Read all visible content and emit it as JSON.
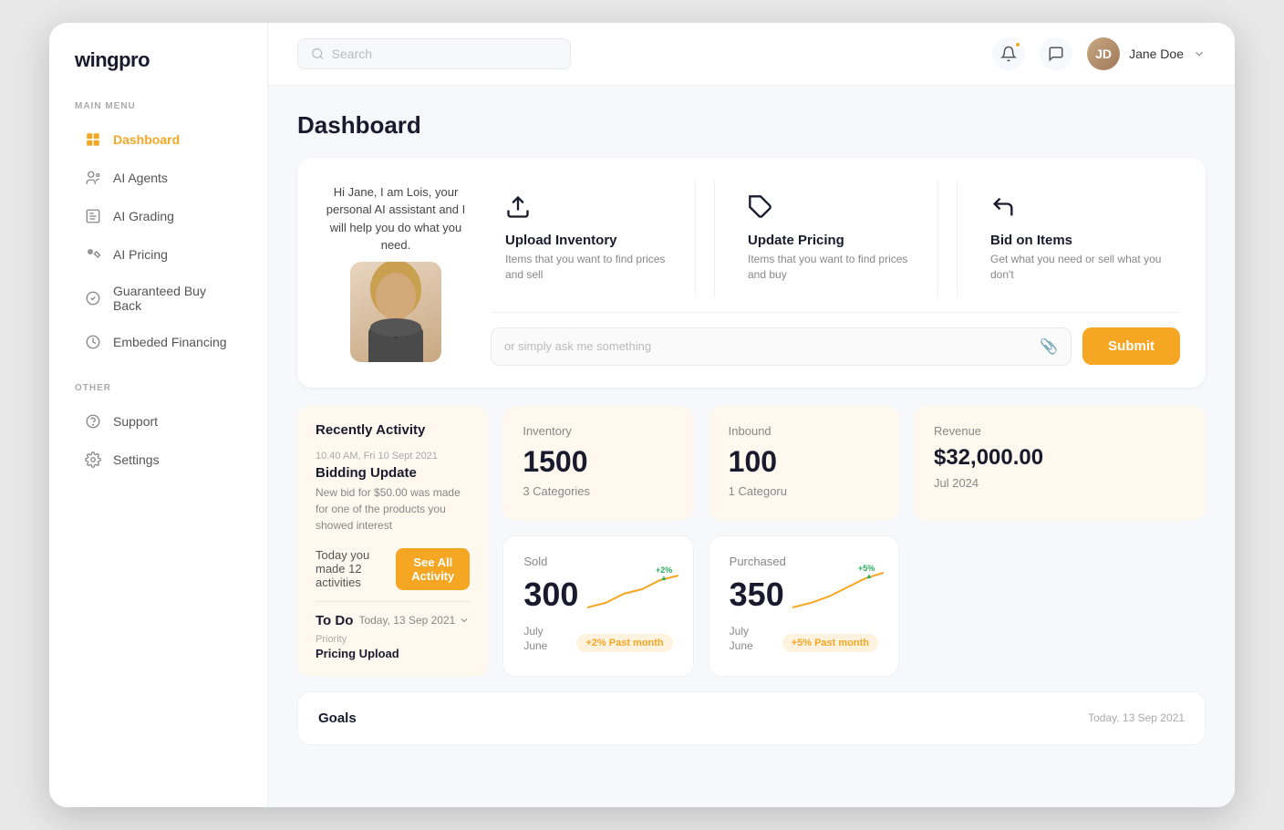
{
  "app": {
    "name": "wingpro"
  },
  "sidebar": {
    "main_menu_label": "MAIN MENU",
    "other_label": "OTHER",
    "items": [
      {
        "id": "dashboard",
        "label": "Dashboard",
        "active": true
      },
      {
        "id": "ai-agents",
        "label": "AI Agents",
        "active": false
      },
      {
        "id": "ai-grading",
        "label": "AI Grading",
        "active": false
      },
      {
        "id": "ai-pricing",
        "label": "AI Pricing",
        "active": false
      },
      {
        "id": "guaranteed-buyback",
        "label": "Guaranteed Buy Back",
        "active": false
      },
      {
        "id": "embedded-financing",
        "label": "Embeded Financing",
        "active": false
      }
    ],
    "other_items": [
      {
        "id": "support",
        "label": "Support"
      },
      {
        "id": "settings",
        "label": "Settings"
      }
    ]
  },
  "topbar": {
    "search_placeholder": "Search",
    "user_name": "Jane Doe"
  },
  "page": {
    "title": "Dashboard"
  },
  "ai_banner": {
    "greeting": "Hi Jane, I am Lois, your personal AI assistant and I will help you do what you need.",
    "actions": [
      {
        "title": "Upload Inventory",
        "description": "Items that you want to find prices and sell",
        "icon": "↑"
      },
      {
        "title": "Update Pricing",
        "description": "Items that you want to find prices and buy",
        "icon": "◇"
      },
      {
        "title": "Bid on Items",
        "description": "Get what you need or sell what you don't",
        "icon": "←"
      }
    ],
    "input_placeholder": "or simply ask me something",
    "submit_label": "Submit"
  },
  "stats": [
    {
      "label": "Inventory",
      "value": "1500",
      "sub": "3 Categories"
    },
    {
      "label": "Inbound",
      "value": "100",
      "sub": "1 Categoru"
    },
    {
      "label": "Revenue",
      "value": "$32,000.00",
      "sub": "Jul 2024"
    }
  ],
  "activity": {
    "title": "Recently Activity",
    "timestamp": "10.40 AM, Fri 10 Sept 2021",
    "event_title": "Bidding Update",
    "event_desc": "New bid for $50.00 was made for one of the products you showed interest",
    "count_text": "Today you made 12 activities",
    "see_all_label": "See All Activity"
  },
  "todo": {
    "title": "To Do",
    "date_label": "Today, 13 Sep 2021",
    "priority_label": "Priority",
    "item_title": "Pricing Upload"
  },
  "metrics": [
    {
      "label": "Sold",
      "value": "300",
      "month_current": "July",
      "month_past": "June",
      "badge_text": "+2% Past month",
      "badge_type": "badge-orange",
      "change_pct": "+2%"
    },
    {
      "label": "Purchased",
      "value": "350",
      "month_current": "July",
      "month_past": "June",
      "badge_text": "+5% Past month",
      "badge_type": "badge-orange",
      "change_pct": "+5%"
    }
  ],
  "goals": {
    "title": "Goals",
    "date_label": "Today, 13 Sep 2021"
  },
  "colors": {
    "accent": "#f5a623",
    "sidebar_active": "#f5a623",
    "stat_bg": "#fff8ee"
  }
}
